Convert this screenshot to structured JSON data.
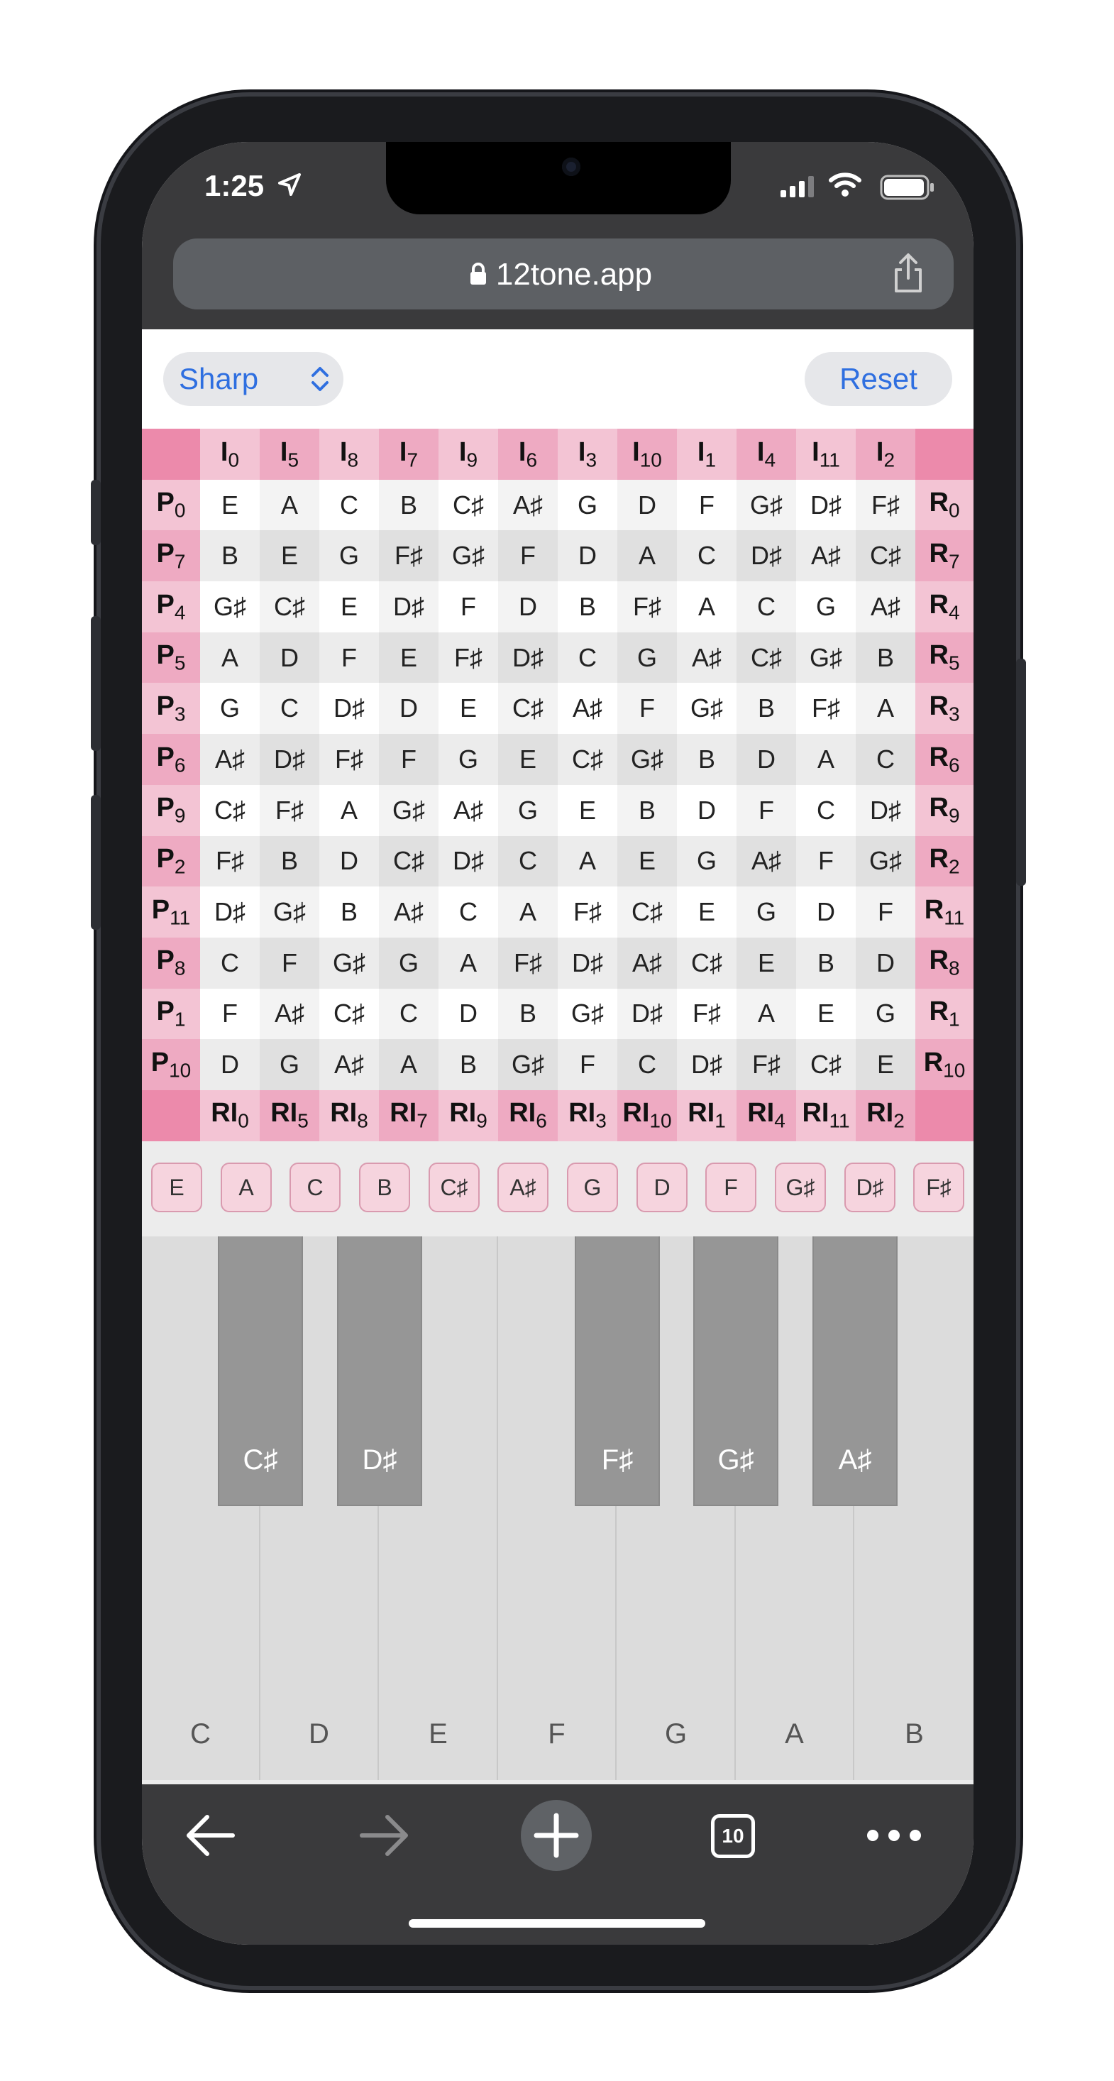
{
  "status": {
    "time": "1:25"
  },
  "browser": {
    "url": "12tone.app",
    "tab_count": "10"
  },
  "controls": {
    "accidental_mode": "Sharp",
    "reset_label": "Reset"
  },
  "matrix": {
    "top_labels": [
      [
        "I",
        "0"
      ],
      [
        "I",
        "5"
      ],
      [
        "I",
        "8"
      ],
      [
        "I",
        "7"
      ],
      [
        "I",
        "9"
      ],
      [
        "I",
        "6"
      ],
      [
        "I",
        "3"
      ],
      [
        "I",
        "10"
      ],
      [
        "I",
        "1"
      ],
      [
        "I",
        "4"
      ],
      [
        "I",
        "11"
      ],
      [
        "I",
        "2"
      ]
    ],
    "bottom_labels": [
      [
        "RI",
        "0"
      ],
      [
        "RI",
        "5"
      ],
      [
        "RI",
        "8"
      ],
      [
        "RI",
        "7"
      ],
      [
        "RI",
        "9"
      ],
      [
        "RI",
        "6"
      ],
      [
        "RI",
        "3"
      ],
      [
        "RI",
        "10"
      ],
      [
        "RI",
        "1"
      ],
      [
        "RI",
        "4"
      ],
      [
        "RI",
        "11"
      ],
      [
        "RI",
        "2"
      ]
    ],
    "left_labels": [
      [
        "P",
        "0"
      ],
      [
        "P",
        "7"
      ],
      [
        "P",
        "4"
      ],
      [
        "P",
        "5"
      ],
      [
        "P",
        "3"
      ],
      [
        "P",
        "6"
      ],
      [
        "P",
        "9"
      ],
      [
        "P",
        "2"
      ],
      [
        "P",
        "11"
      ],
      [
        "P",
        "8"
      ],
      [
        "P",
        "1"
      ],
      [
        "P",
        "10"
      ]
    ],
    "right_labels": [
      [
        "R",
        "0"
      ],
      [
        "R",
        "7"
      ],
      [
        "R",
        "4"
      ],
      [
        "R",
        "5"
      ],
      [
        "R",
        "3"
      ],
      [
        "R",
        "6"
      ],
      [
        "R",
        "9"
      ],
      [
        "R",
        "2"
      ],
      [
        "R",
        "11"
      ],
      [
        "R",
        "8"
      ],
      [
        "R",
        "1"
      ],
      [
        "R",
        "10"
      ]
    ],
    "rows": [
      [
        "E",
        "A",
        "C",
        "B",
        "C♯",
        "A♯",
        "G",
        "D",
        "F",
        "G♯",
        "D♯",
        "F♯"
      ],
      [
        "B",
        "E",
        "G",
        "F♯",
        "G♯",
        "F",
        "D",
        "A",
        "C",
        "D♯",
        "A♯",
        "C♯"
      ],
      [
        "G♯",
        "C♯",
        "E",
        "D♯",
        "F",
        "D",
        "B",
        "F♯",
        "A",
        "C",
        "G",
        "A♯"
      ],
      [
        "A",
        "D",
        "F",
        "E",
        "F♯",
        "D♯",
        "C",
        "G",
        "A♯",
        "C♯",
        "G♯",
        "B"
      ],
      [
        "G",
        "C",
        "D♯",
        "D",
        "E",
        "C♯",
        "A♯",
        "F",
        "G♯",
        "B",
        "F♯",
        "A"
      ],
      [
        "A♯",
        "D♯",
        "F♯",
        "F",
        "G",
        "E",
        "C♯",
        "G♯",
        "B",
        "D",
        "A",
        "C"
      ],
      [
        "C♯",
        "F♯",
        "A",
        "G♯",
        "A♯",
        "G",
        "E",
        "B",
        "D",
        "F",
        "C",
        "D♯"
      ],
      [
        "F♯",
        "B",
        "D",
        "C♯",
        "D♯",
        "C",
        "A",
        "E",
        "G",
        "A♯",
        "F",
        "G♯"
      ],
      [
        "D♯",
        "G♯",
        "B",
        "A♯",
        "C",
        "A",
        "F♯",
        "C♯",
        "E",
        "G",
        "D",
        "F"
      ],
      [
        "C",
        "F",
        "G♯",
        "G",
        "A",
        "F♯",
        "D♯",
        "A♯",
        "C♯",
        "E",
        "B",
        "D"
      ],
      [
        "F",
        "A♯",
        "C♯",
        "C",
        "D",
        "B",
        "G♯",
        "D♯",
        "F♯",
        "A",
        "E",
        "G"
      ],
      [
        "D",
        "G",
        "A♯",
        "A",
        "B",
        "G♯",
        "F",
        "C",
        "D♯",
        "F♯",
        "C♯",
        "E"
      ]
    ]
  },
  "tone_row": [
    "E",
    "A",
    "C",
    "B",
    "C♯",
    "A♯",
    "G",
    "D",
    "F",
    "G♯",
    "D♯",
    "F♯"
  ],
  "piano": {
    "white_keys": [
      "C",
      "D",
      "E",
      "F",
      "G",
      "A",
      "B"
    ],
    "black_keys": [
      "C♯",
      "D♯",
      "F♯",
      "G♯",
      "A♯"
    ]
  },
  "colors": {
    "header_pink": "#f3c4d4",
    "header_pink_alt": "#eeaac2",
    "corner_pink": "#ec8aab",
    "link_blue": "#2f6fe0"
  }
}
